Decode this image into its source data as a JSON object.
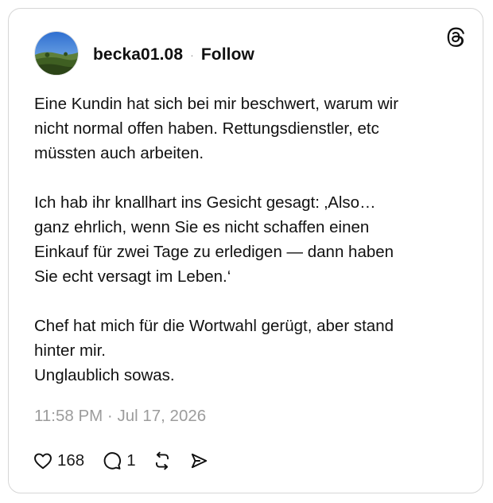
{
  "post": {
    "username": "becka01.08",
    "separator": "·",
    "follow_label": "Follow",
    "text": "Eine Kundin hat sich bei mir beschwert, warum wir\nnicht normal offen haben. Rettungsdienstler, etc\nmüssten auch arbeiten.\n\nIch hab ihr knallhart ins Gesicht gesagt: ‚Also…\nganz ehrlich, wenn Sie es nicht schaffen einen\nEinkauf für zwei Tage zu erledigen — dann haben\nSie echt versagt im Leben.‘\n\nChef hat mich für die Wortwahl gerügt, aber stand\nhinter mir.\nUnglaublich sowas.",
    "timestamp": "11:58 PM · Jul 17, 2026"
  },
  "actions": {
    "like_count": "168",
    "reply_count": "1"
  },
  "icons": {
    "brand": "threads-logo-icon",
    "like": "heart-icon",
    "reply": "comment-icon",
    "repost": "repost-icon",
    "share": "send-icon"
  },
  "colors": {
    "text": "#101010",
    "muted": "#9c9c9c",
    "border": "#d6d6d6"
  }
}
